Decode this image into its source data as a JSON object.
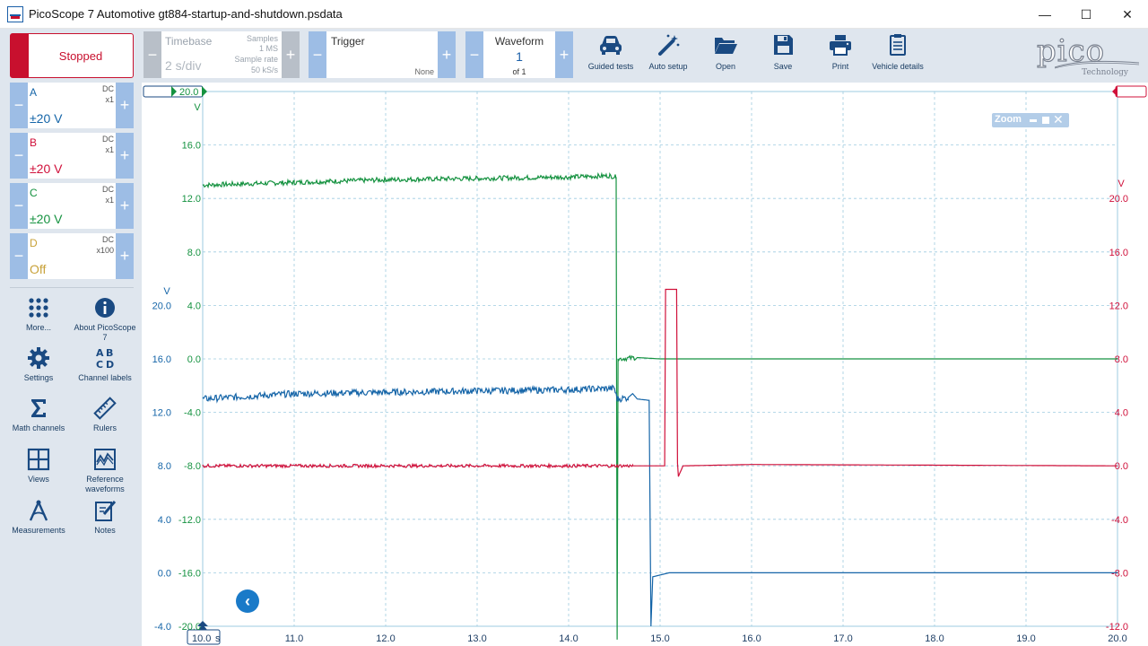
{
  "window": {
    "title": "PicoScope 7 Automotive gt884-startup-and-shutdown.psdata",
    "min_glyph": "—",
    "max_glyph": "☐",
    "close_glyph": "✕"
  },
  "toolbar": {
    "status": "Stopped",
    "timebase": {
      "label": "Timebase",
      "value": "2 s/div",
      "samples_label": "Samples",
      "samples_value": "1 MS",
      "rate_label": "Sample rate",
      "rate_value": "50 kS/s"
    },
    "trigger": {
      "label": "Trigger",
      "mode": "None"
    },
    "waveform": {
      "label": "Waveform",
      "value": "1",
      "of": "of 1"
    },
    "stepper_minus": "−",
    "stepper_plus": "+",
    "tools": [
      {
        "label": "Guided tests",
        "icon": "car-icon"
      },
      {
        "label": "Auto setup",
        "icon": "magic-wand-icon"
      },
      {
        "label": "Open",
        "icon": "folder-icon"
      },
      {
        "label": "Save",
        "icon": "floppy-disk-icon"
      },
      {
        "label": "Print",
        "icon": "printer-icon"
      },
      {
        "label": "Vehicle details",
        "icon": "clipboard-icon"
      }
    ],
    "logo": {
      "word": "pico",
      "sub": "Technology"
    }
  },
  "channels": [
    {
      "name": "A",
      "coupling": "DC",
      "probe": "x1",
      "range": "±20 V",
      "color": "#1565a8"
    },
    {
      "name": "B",
      "coupling": "DC",
      "probe": "x1",
      "range": "±20 V",
      "color": "#d0103a"
    },
    {
      "name": "C",
      "coupling": "DC",
      "probe": "x1",
      "range": "±20 V",
      "color": "#159240"
    },
    {
      "name": "D",
      "coupling": "DC",
      "probe": "x100",
      "range": "Off",
      "color": "#c8a23a"
    }
  ],
  "left_tools": [
    {
      "label": "More...",
      "icon": "grid-dots-icon"
    },
    {
      "label": "About PicoScope 7",
      "icon": "info-icon"
    },
    {
      "label": "Settings",
      "icon": "gear-icon"
    },
    {
      "label": "Channel labels",
      "icon": "abcd-icon"
    },
    {
      "label": "Math channels",
      "icon": "sigma-icon"
    },
    {
      "label": "Rulers",
      "icon": "ruler-icon"
    },
    {
      "label": "Views",
      "icon": "views-grid-icon"
    },
    {
      "label": "Reference waveforms",
      "icon": "reference-waveform-icon"
    },
    {
      "label": "Measurements",
      "icon": "caliper-icon"
    },
    {
      "label": "Notes",
      "icon": "notes-icon"
    }
  ],
  "scope": {
    "zoom_label": "Zoom",
    "back_glyph": "‹",
    "ruler_left_label": "20.0",
    "x_start_label": "10.0",
    "x_unit": "s",
    "grid_color": "#9dcbe0"
  },
  "chart_data": {
    "type": "line",
    "x_label": "s",
    "x_ticks": [
      "10.0",
      "11.0",
      "12.0",
      "13.0",
      "14.0",
      "15.0",
      "16.0",
      "17.0",
      "18.0",
      "19.0",
      "20.0"
    ],
    "xlim": [
      10,
      20
    ],
    "axes": [
      {
        "channel": "C",
        "unit": "V",
        "color": "#159240",
        "ticks": [
          "16.0",
          "12.0",
          "8.0",
          "4.0",
          "0.0",
          "-4.0",
          "-8.0",
          "-12.0",
          "-16.0",
          "-20.0"
        ],
        "ylim": [
          -20,
          20
        ]
      },
      {
        "channel": "A",
        "unit": "V",
        "color": "#1565a8",
        "ticks": [
          "20.0",
          "16.0",
          "12.0",
          "8.0",
          "4.0",
          "0.0",
          "-4.0"
        ],
        "ylim": [
          -4,
          36
        ]
      },
      {
        "channel": "B",
        "unit": "V",
        "color": "#d0103a",
        "ticks": [
          "20.0",
          "16.0",
          "12.0",
          "8.0",
          "4.0",
          "0.0",
          "-4.0",
          "-8.0",
          "-12.0"
        ],
        "ylim": [
          -12,
          28
        ]
      }
    ],
    "series": [
      {
        "channel": "C",
        "color": "#159240",
        "axis": 0,
        "noise": 0.18,
        "points": [
          [
            10.0,
            13.0
          ],
          [
            11.0,
            13.2
          ],
          [
            12.0,
            13.4
          ],
          [
            13.0,
            13.5
          ],
          [
            14.0,
            13.6
          ],
          [
            14.45,
            13.7
          ],
          [
            14.52,
            13.6
          ],
          [
            14.53,
            -21.0
          ],
          [
            14.54,
            0.0
          ],
          [
            14.75,
            0.1
          ],
          [
            15.0,
            0.0
          ],
          [
            20.0,
            0.0
          ]
        ]
      },
      {
        "channel": "A",
        "color": "#1565a8",
        "axis": 1,
        "noise": 0.25,
        "points": [
          [
            10.0,
            13.0
          ],
          [
            11.0,
            13.4
          ],
          [
            12.0,
            13.5
          ],
          [
            13.0,
            13.6
          ],
          [
            14.0,
            13.7
          ],
          [
            14.5,
            13.8
          ],
          [
            14.53,
            13.0
          ],
          [
            14.65,
            13.1
          ],
          [
            14.7,
            13.4
          ],
          [
            14.75,
            13.0
          ],
          [
            14.88,
            12.9
          ],
          [
            14.9,
            -4.0
          ],
          [
            14.92,
            -0.3
          ],
          [
            15.1,
            0.0
          ],
          [
            20.0,
            0.0
          ]
        ]
      },
      {
        "channel": "B",
        "color": "#d0103a",
        "axis": 2,
        "noise": 0.12,
        "points": [
          [
            10.0,
            0.0
          ],
          [
            14.5,
            0.0
          ],
          [
            14.7,
            0.0
          ],
          [
            15.05,
            0.0
          ],
          [
            15.06,
            13.2
          ],
          [
            15.18,
            13.2
          ],
          [
            15.19,
            0.2
          ],
          [
            15.2,
            -0.8
          ],
          [
            15.25,
            0.0
          ],
          [
            16.0,
            0.1
          ],
          [
            20.0,
            0.0
          ]
        ]
      }
    ]
  }
}
